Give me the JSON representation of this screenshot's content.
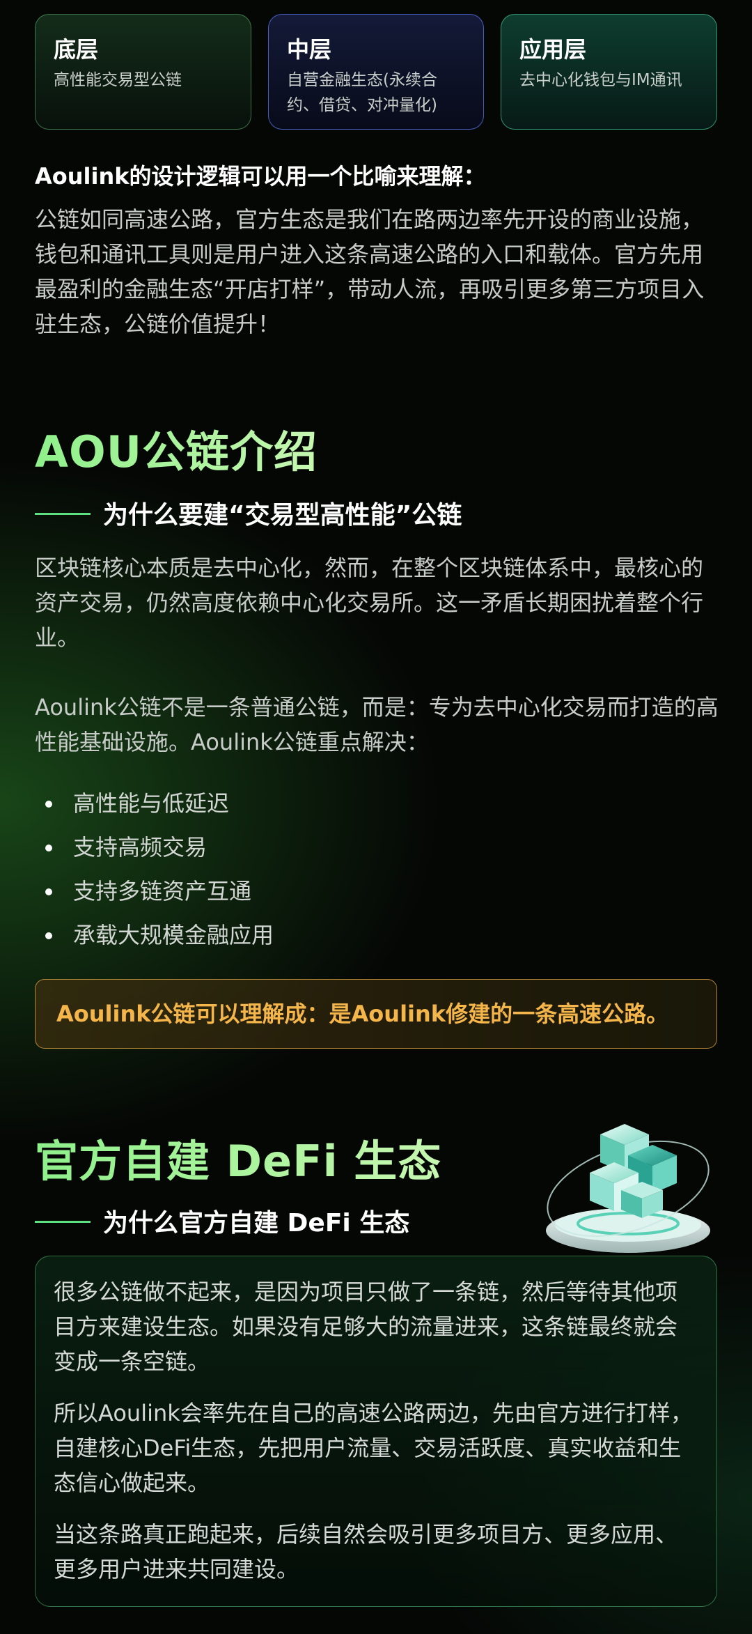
{
  "layers": [
    {
      "title": "底层",
      "desc": "高性能交易型公链"
    },
    {
      "title": "中层",
      "desc": "自营金融生态(永续合约、借贷、对冲量化)"
    },
    {
      "title": "应用层",
      "desc": "去中心化钱包与IM通讯"
    }
  ],
  "intro": {
    "heading": "Aoulink的设计逻辑可以用一个比喻来理解：",
    "body": "公链如同高速公路，官方生态是我们在路两边率先开设的商业设施，钱包和通讯工具则是用户进入这条高速公路的入口和载体。官方先用最盈利的金融生态“开店打样”，带动人流，再吸引更多第三方项目入驻生态，公链价值提升！"
  },
  "aou_section": {
    "title": "AOU公链介绍",
    "subtitle": "为什么要建“交易型高性能”公链",
    "para1": "区块链核心本质是去中心化，然而，在整个区块链体系中，最核心的资产交易，仍然高度依赖中心化交易所。这一矛盾长期困扰着整个行业。",
    "para2": "Aoulink公链不是一条普通公链，而是：专为去中心化交易而打造的高性能基础设施。Aoulink公链重点解决：",
    "bullets": [
      "高性能与低延迟",
      "支持高频交易",
      "支持多链资产互通",
      "承载大规模金融应用"
    ],
    "callout": "Aoulink公链可以理解成：是Aoulink修建的一条高速公路。"
  },
  "defi_section": {
    "title": "官方自建 DeFi 生态",
    "subtitle": "为什么官方自建 DeFi 生态",
    "paragraphs": [
      "很多公链做不起来，是因为项目只做了一条链，然后等待其他项目方来建设生态。如果没有足够大的流量进来，这条链最终就会变成一条空链。",
      "所以Aoulink会率先在自己的高速公路两边，先由官方进行打样，自建核心DeFi生态，先把用户流量、交易活跃度、真实收益和生态信心做起来。",
      "当这条路真正跑起来，后续自然会吸引更多项目方、更多应用、更多用户进来共同建设。"
    ]
  },
  "colors": {
    "accent_green": "#5fe080",
    "callout_text": "#f4b64a",
    "background": "#050705"
  },
  "icons": {
    "hero": "blockchain-cubes-icon"
  }
}
